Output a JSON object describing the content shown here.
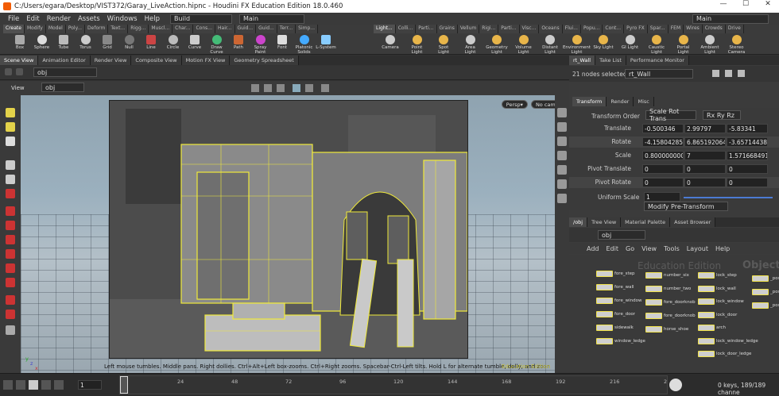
{
  "window": {
    "title": "C:/Users/egara/Desktop/VIST372/Garay_LiveAction.hipnc - Houdini FX Education Edition 18.0.460",
    "min": "—",
    "max": "☐",
    "close": "✕"
  },
  "menubar": {
    "items": [
      "File",
      "Edit",
      "Render",
      "Assets",
      "Windows",
      "Help"
    ],
    "desktop": "Build",
    "desktop_right": "Main",
    "main_label": "Main"
  },
  "shelf": {
    "left_tabs": [
      "Create",
      "Modify",
      "Model",
      "Poly...",
      "Deform",
      "Text...",
      "Rigg...",
      "Muscl...",
      "Char...",
      "Cons...",
      "Hair...",
      "Guid...",
      "Guid...",
      "Terr...",
      "Simp..."
    ],
    "right_tabs": [
      "Light...",
      "Colli...",
      "Parti...",
      "Grains",
      "Vellum",
      "Rigi...",
      "Parti...",
      "Visc...",
      "Oceans",
      "Flui...",
      "Popu...",
      "Cont...",
      "Pyro FX",
      "Spar...",
      "FEM",
      "Wires",
      "Crowds",
      "Drive"
    ],
    "left_tools": [
      "Box",
      "Sphere",
      "Tube",
      "Torus",
      "Grid",
      "Null",
      "Line",
      "Circle",
      "Curve",
      "Draw Curve",
      "Path",
      "Spray Paint",
      "Font",
      "Platonic Solids",
      "L-System"
    ],
    "right_tools": [
      "Camera",
      "Point Light",
      "Spot Light",
      "Area Light",
      "Geometry Light",
      "Volume Light",
      "Distant Light",
      "Environment Light",
      "Sky Light",
      "GI Light",
      "Caustic Light",
      "Portal Light",
      "Ambient Light",
      "Stereo Camera"
    ]
  },
  "left_pane": {
    "tabs": [
      "Scene View",
      "Animation Editor",
      "Render View",
      "Composite View",
      "Motion FX View",
      "Geometry Spreadsheet"
    ],
    "path": "obj",
    "view_label": "View",
    "view_path": "obj",
    "persp": "Persp▾",
    "cam": "No cam▾",
    "hint": "Left mouse tumbles. Middle pans. Right dollies. Ctrl+Alt+Left box-zooms. Ctrl+Right zooms. Spacebar-Ctrl-Left tilts. Hold L for alternate tumble, dolly, and zoom.",
    "watermark": "Education Edition",
    "axes": {
      "y": "y",
      "z": "z",
      "x": "x"
    }
  },
  "right_pane": {
    "tabs_top": [
      "rt_Wall",
      "Take List",
      "Performance Monitor"
    ],
    "selected_info": "21 nodes selected:",
    "node_name": "rt_Wall",
    "parm_tabs": [
      "Transform",
      "Render",
      "Misc"
    ],
    "transform_order_label": "Transform Order",
    "transform_order": "Scale Rot Trans",
    "rot_order": "Rx Ry Rz",
    "params": [
      {
        "label": "Translate",
        "values": [
          "-0.500346",
          "2.99797",
          "-5.83341"
        ]
      },
      {
        "label": "Rotate",
        "values": [
          "-4.15804285",
          "6.865192064",
          "-3.65714438"
        ]
      },
      {
        "label": "Scale",
        "values": [
          "0.800000000",
          "7",
          "1.571668491"
        ]
      },
      {
        "label": "Pivot Translate",
        "values": [
          "0",
          "0",
          "0"
        ]
      },
      {
        "label": "Pivot Rotate",
        "values": [
          "0",
          "0",
          "0"
        ]
      }
    ],
    "uniform_scale_label": "Uniform Scale",
    "uniform_scale": "1",
    "modify_pre": "Modify Pre-Transform",
    "net_tabs": [
      "/obj",
      "Tree View",
      "Material Palette",
      "Asset Browser"
    ],
    "net_path": "obj",
    "net_menu": [
      "Add",
      "Edit",
      "Go",
      "View",
      "Tools",
      "Layout",
      "Help"
    ],
    "net_watermark": "Education Edition",
    "net_watermark2": "Object",
    "nodes_col1": [
      "fore_step",
      "fore_wall",
      "fore_window",
      "fore_door",
      "sidewalk",
      "window_ledge"
    ],
    "nodes_col2": [
      "number_six",
      "number_two",
      "fore_doorknob",
      "fore_doorknob",
      "horse_shoe"
    ],
    "nodes_col3": [
      "lock_step",
      "lock_wall",
      "lock_window",
      "lock_door",
      "arch",
      "lock_window_ledge",
      "lock_door_ledge"
    ],
    "nodes_col4": [
      "_post",
      "_post",
      "_post"
    ]
  },
  "timeline": {
    "ticks": [
      "1",
      "24",
      "48",
      "72",
      "96",
      "120",
      "144",
      "168",
      "192",
      "216",
      "2"
    ],
    "current_frame": "1",
    "frame_field": "1",
    "status": "0 keys, 189/189 channe"
  }
}
